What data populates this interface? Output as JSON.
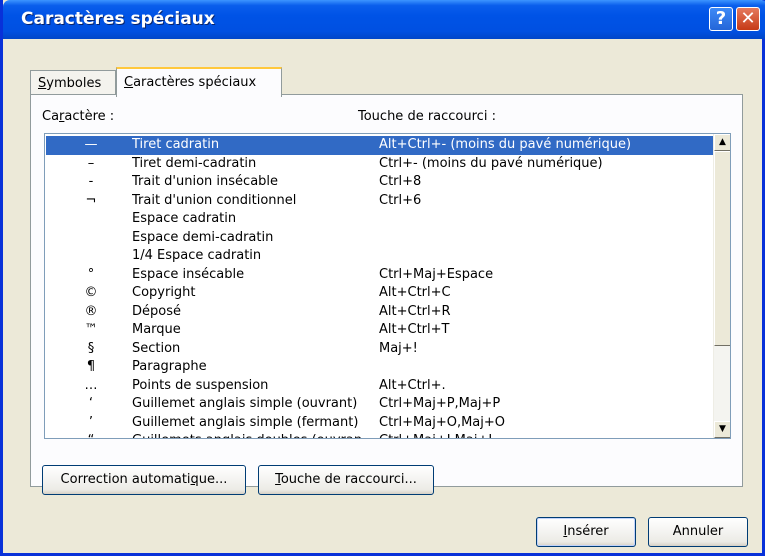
{
  "window": {
    "title": "Caractères spéciaux",
    "help_glyph": "?",
    "close_glyph": "✕"
  },
  "tabs": [
    {
      "label": "Symboles",
      "accel": "S",
      "rest": "ymboles"
    },
    {
      "label": "Caractères spéciaux",
      "accel": "C",
      "rest": "aractères spéciaux"
    }
  ],
  "headers": {
    "character_pre": "Ca",
    "character_accel": "r",
    "character_post": "actère :",
    "shortcut": "Touche de raccourci :"
  },
  "rows": [
    {
      "symbol": "—",
      "name": "Tiret cadratin",
      "shortcut": "Alt+Ctrl+- (moins du pavé numérique)",
      "selected": true
    },
    {
      "symbol": "–",
      "name": "Tiret demi-cadratin",
      "shortcut": "Ctrl+- (moins du pavé numérique)"
    },
    {
      "symbol": "-",
      "name": "Trait d'union insécable",
      "shortcut": "Ctrl+8"
    },
    {
      "symbol": "¬",
      "name": "Trait d'union conditionnel",
      "shortcut": "Ctrl+6"
    },
    {
      "symbol": "",
      "name": "Espace cadratin",
      "shortcut": ""
    },
    {
      "symbol": "",
      "name": "Espace demi-cadratin",
      "shortcut": ""
    },
    {
      "symbol": "",
      "name": "1/4 Espace cadratin",
      "shortcut": ""
    },
    {
      "symbol": "°",
      "name": "Espace insécable",
      "shortcut": "Ctrl+Maj+Espace"
    },
    {
      "symbol": "©",
      "name": "Copyright",
      "shortcut": "Alt+Ctrl+C"
    },
    {
      "symbol": "®",
      "name": "Déposé",
      "shortcut": "Alt+Ctrl+R"
    },
    {
      "symbol": "™",
      "name": "Marque",
      "shortcut": "Alt+Ctrl+T"
    },
    {
      "symbol": "§",
      "name": "Section",
      "shortcut": "Maj+!"
    },
    {
      "symbol": "¶",
      "name": "Paragraphe",
      "shortcut": ""
    },
    {
      "symbol": "…",
      "name": "Points de suspension",
      "shortcut": "Alt+Ctrl+."
    },
    {
      "symbol": "‘",
      "name": "Guillemet anglais simple (ouvrant)",
      "shortcut": "Ctrl+Maj+P,Maj+P"
    },
    {
      "symbol": "’",
      "name": "Guillemet anglais simple (fermant)",
      "shortcut": "Ctrl+Maj+O,Maj+O"
    },
    {
      "symbol": "“",
      "name": "Guillemets anglais doubles (ouvran…",
      "shortcut": "Ctrl+Maj+I,Maj+I"
    }
  ],
  "scrollbar": {
    "up_glyph": "▲",
    "down_glyph": "▼"
  },
  "buttons": {
    "autocorrect": {
      "label": "Correction automatique...",
      "pre": "Correction automati",
      "accel": "q",
      "post": "ue..."
    },
    "shortcut": {
      "label": "Touche de raccourci...",
      "pre": "",
      "accel": "T",
      "post": "ouche de raccourci..."
    },
    "insert": {
      "label": "Insérer",
      "pre": "",
      "accel": "I",
      "post": "nsérer"
    },
    "cancel": {
      "label": "Annuler"
    }
  }
}
